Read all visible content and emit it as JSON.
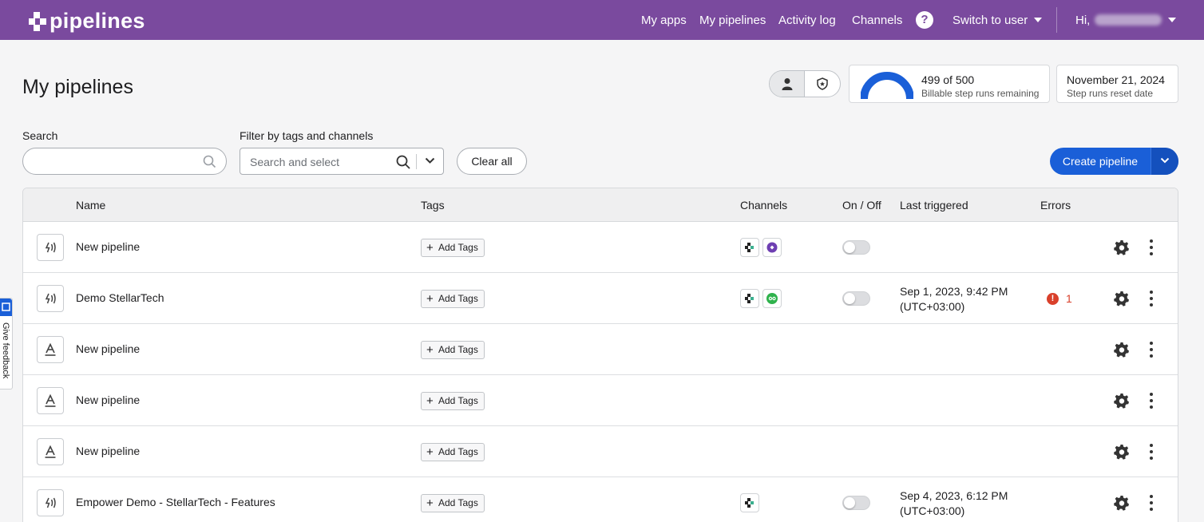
{
  "app": {
    "logo_text": "pipelines",
    "accent": "#7a4a9e",
    "primary": "#1a5fd8"
  },
  "nav": {
    "items": [
      "My apps",
      "My pipelines",
      "Activity log",
      "Channels"
    ],
    "help_glyph": "?",
    "switch_user": "Switch to user",
    "greeting": "Hi,"
  },
  "page": {
    "title": "My pipelines"
  },
  "usage": {
    "used": 499,
    "total": 500,
    "main": "499 of 500",
    "sub": "Billable step runs remaining",
    "remaining_fraction": 0.998
  },
  "reset": {
    "date": "November 21, 2024",
    "sub": "Step runs reset date"
  },
  "filters": {
    "search_label": "Search",
    "search_value": "",
    "tags_label": "Filter by tags and channels",
    "tags_placeholder": "Search and select",
    "clear_all": "Clear all",
    "create": "Create pipeline"
  },
  "table": {
    "columns": [
      "Name",
      "Tags",
      "Channels",
      "On / Off",
      "Last triggered",
      "Errors"
    ],
    "add_tags_label": "Add Tags",
    "rows": [
      {
        "name": "New pipeline",
        "icon": "broadcast-icon",
        "channels": [
          "pipelines-channel-icon",
          "purple-channel-icon"
        ],
        "toggle": true,
        "last_triggered_1": "",
        "last_triggered_2": "",
        "errors": ""
      },
      {
        "name": "Demo StellarTech",
        "icon": "broadcast-icon",
        "channels": [
          "pipelines-channel-icon",
          "green-channel-icon"
        ],
        "toggle": true,
        "last_triggered_1": "Sep 1, 2023, 9:42 PM",
        "last_triggered_2": "(UTC+03:00)",
        "errors": "1"
      },
      {
        "name": "New pipeline",
        "icon": "text-a-icon",
        "channels": [],
        "toggle": false,
        "last_triggered_1": "",
        "last_triggered_2": "",
        "errors": ""
      },
      {
        "name": "New pipeline",
        "icon": "text-a-icon",
        "channels": [],
        "toggle": false,
        "last_triggered_1": "",
        "last_triggered_2": "",
        "errors": ""
      },
      {
        "name": "New pipeline",
        "icon": "text-a-icon",
        "channels": [],
        "toggle": false,
        "last_triggered_1": "",
        "last_triggered_2": "",
        "errors": ""
      },
      {
        "name": "Empower Demo - StellarTech - Features",
        "icon": "broadcast-icon",
        "channels": [
          "pipelines-channel-icon"
        ],
        "toggle": true,
        "last_triggered_1": "Sep 4, 2023, 6:12 PM",
        "last_triggered_2": "(UTC+03:00)",
        "errors": ""
      }
    ]
  },
  "feedback": {
    "label": "Give feedback"
  }
}
